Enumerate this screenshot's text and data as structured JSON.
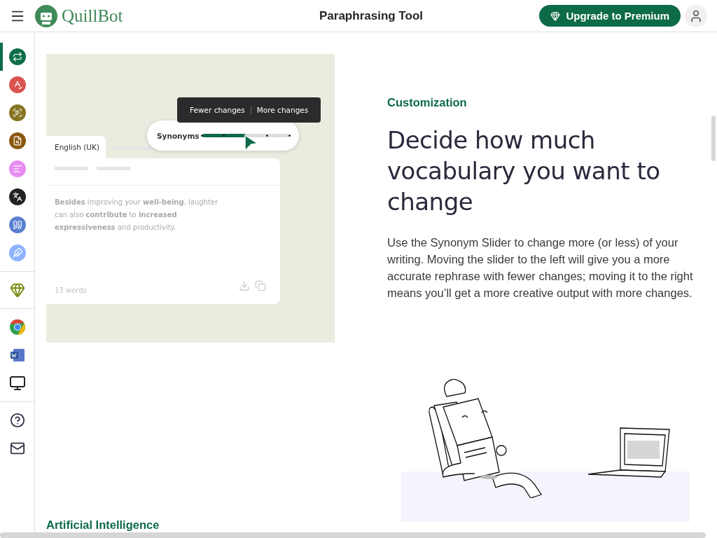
{
  "header": {
    "logo": "QuillBot",
    "title": "Paraphrasing Tool",
    "upgrade_button": "Upgrade to Premium"
  },
  "sidebar": {
    "tools": [
      {
        "selected": true,
        "color": "#0f6e4a"
      },
      {
        "selected": false,
        "color": "#d9534f"
      },
      {
        "selected": false,
        "color": "#857420"
      },
      {
        "selected": false,
        "color": "#8a5810"
      },
      {
        "selected": false,
        "color": "#e68cf2"
      },
      {
        "selected": false,
        "color": "#222222"
      },
      {
        "selected": false,
        "color": "#5b80cf"
      },
      {
        "selected": false,
        "color": "#8fb4ff"
      }
    ]
  },
  "demo": {
    "tab": "English (UK)",
    "tooltip": [
      "Fewer changes",
      "More changes"
    ],
    "slider": {
      "label": "Synonyms",
      "level": 0.5
    },
    "text": "**Besides** improving your **well-being**, laughter can also **contribute** to **increased expressiveness** and productivity.",
    "word_count": "13 words"
  },
  "feature": {
    "eyebrow": "Customization",
    "heading": "Decide how much vocabulary you want to change",
    "body": "Use the Synonym Slider to change more (or less) of your writing. Moving the slider to the left will give you a more accurate rephrase with fewer changes; moving it to the right means you’ll get a more creative output with more changes."
  },
  "next_section": {
    "eyebrow": "Artificial Intelligence"
  }
}
